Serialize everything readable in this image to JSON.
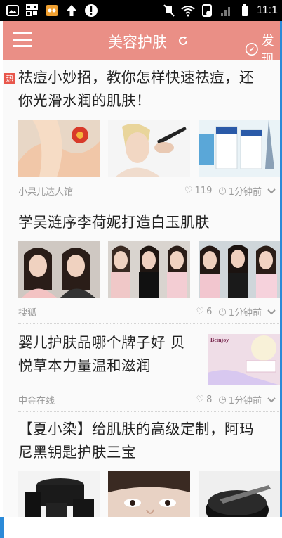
{
  "status_bar": {
    "time": "11:1"
  },
  "app_bar": {
    "title": "美容护肤",
    "discover_label": "发现"
  },
  "hot_badge": "热",
  "articles": [
    {
      "title_line1": "祛痘小妙招，教你怎样快速祛痘，还",
      "title_line2": "你光滑水润的肌肤！",
      "source": "小果儿达人馆",
      "likes": "119",
      "time": "1分钟前"
    },
    {
      "title_line1": "学吴涟序李荷妮打造白玉肌肤",
      "source": "搜狐",
      "likes": "6",
      "time": "1分钟前"
    },
    {
      "title_line1": "婴儿护肤品哪个牌子好 贝",
      "title_line2": "悦草本力量温和滋润",
      "source": "中金在线",
      "likes": "8",
      "time": "1分钟前",
      "thumb_brand": "Beinjoy"
    },
    {
      "title_line1": "【夏小染】给肌肤的高级定制，阿玛",
      "title_line2": "尼黑钥匙护肤三宝"
    }
  ]
}
